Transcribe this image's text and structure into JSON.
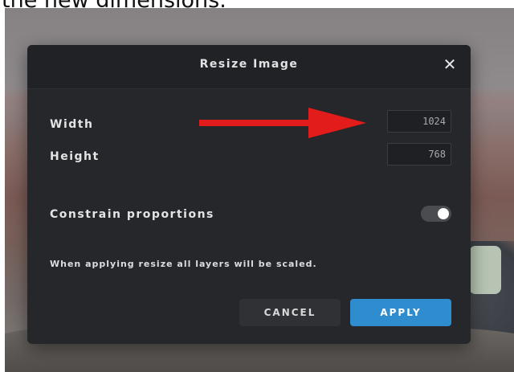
{
  "caption": "the new dimensions.",
  "dialog": {
    "title": "Resize Image",
    "close_symbol": "✕",
    "width_label": "Width",
    "width_value": "1024",
    "height_label": "Height",
    "height_value": "768",
    "constrain_label": "Constrain proportions",
    "constrain_on": true,
    "note": "When applying resize all layers will be scaled.",
    "cancel_label": "CANCEL",
    "apply_label": "APPLY"
  },
  "colors": {
    "apply_button": "#2f8ccf",
    "arrow": "#e21b1b",
    "dialog_bg": "#25272a"
  },
  "icons": {
    "close": "close-icon",
    "annotation": "red-arrow-icon"
  }
}
